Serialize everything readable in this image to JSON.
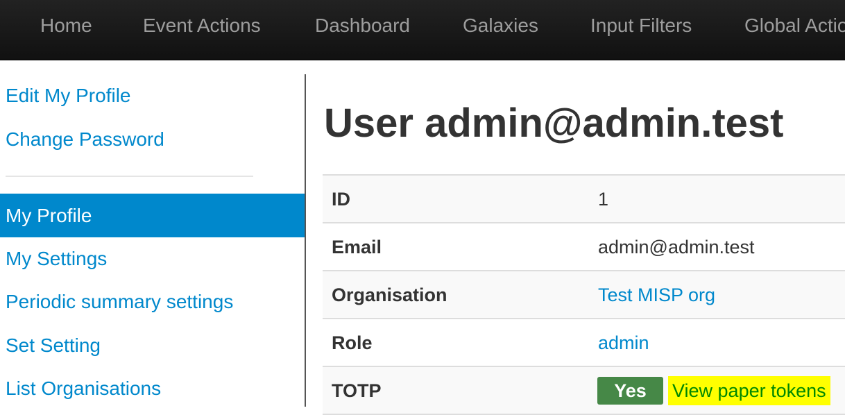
{
  "nav": {
    "items": [
      "Home",
      "Event Actions",
      "Dashboard",
      "Galaxies",
      "Input Filters",
      "Global Actions"
    ]
  },
  "sidebar": {
    "top_links": [
      "Edit My Profile",
      "Change Password"
    ],
    "active": "My Profile",
    "links": [
      "My Settings",
      "Periodic summary settings",
      "Set Setting",
      "List Organisations"
    ]
  },
  "page": {
    "title": "User admin@admin.test"
  },
  "details": {
    "id": {
      "label": "ID",
      "value": "1"
    },
    "email": {
      "label": "Email",
      "value": "admin@admin.test"
    },
    "organisation": {
      "label": "Organisation",
      "value": "Test MISP org"
    },
    "role": {
      "label": "Role",
      "value": "admin"
    },
    "totp": {
      "label": "TOTP",
      "badge": "Yes",
      "link": "View paper tokens"
    }
  },
  "colors": {
    "link": "#0088cc",
    "active_bg": "#0088cc",
    "badge_success": "#468847",
    "highlight": "#ffff00"
  }
}
